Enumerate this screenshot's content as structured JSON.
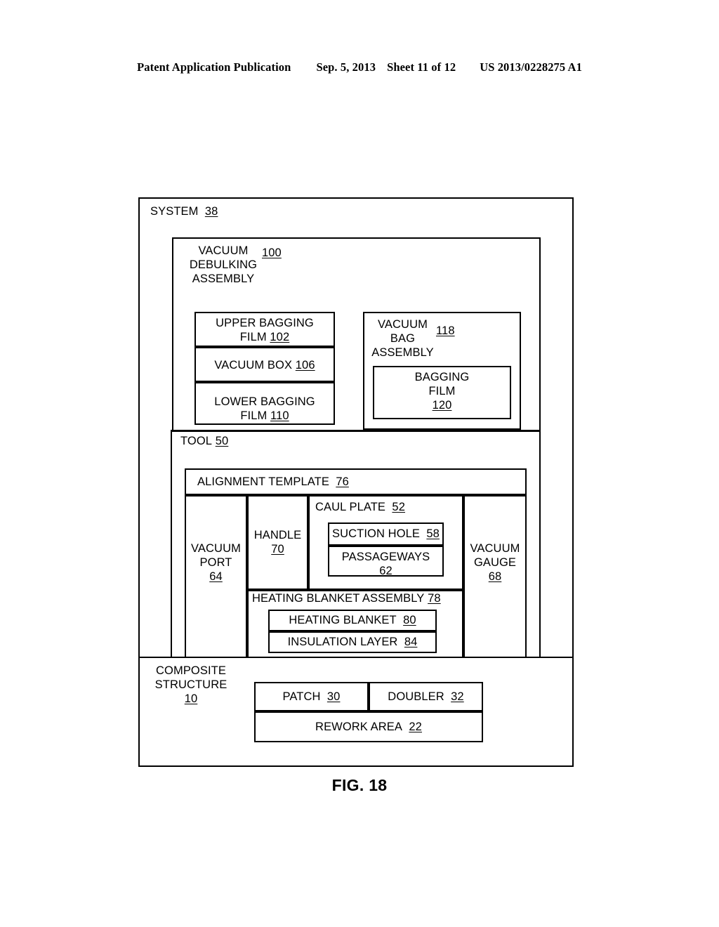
{
  "header": {
    "publication": "Patent Application Publication",
    "date": "Sep. 5, 2013",
    "sheet": "Sheet 11 of 12",
    "docnum": "US 2013/0228275 A1"
  },
  "figure": {
    "caption": "FIG. 18"
  },
  "diagram": {
    "system": {
      "label": "SYSTEM",
      "ref": "38"
    },
    "vacuum_debulking_assembly": {
      "label_line1": "VACUUM",
      "label_line2": "DEBULKING",
      "label_line3": "ASSEMBLY",
      "ref": "100",
      "children": [
        {
          "label": "UPPER BAGGING FILM",
          "label_line1": "UPPER BAGGING",
          "label_line2": "FILM",
          "ref": "102"
        },
        {
          "label": "VACUUM BOX",
          "ref": "106"
        },
        {
          "label": "LOWER BAGGING FILM",
          "label_line1": "LOWER BAGGING",
          "label_line2": "FILM",
          "ref": "110"
        }
      ],
      "vacuum_bag_assembly": {
        "label_line1": "VACUUM",
        "label_line2": "BAG",
        "label_line3": "ASSEMBLY",
        "ref": "118",
        "bagging_film": {
          "label_line1": "BAGGING",
          "label_line2": "FILM",
          "ref": "120"
        }
      }
    },
    "tool": {
      "label": "TOOL",
      "ref": "50",
      "alignment_template": {
        "label": "ALIGNMENT TEMPLATE",
        "ref": "76"
      },
      "vacuum_port": {
        "label_line1": "VACUUM",
        "label_line2": "PORT",
        "ref": "64"
      },
      "handle": {
        "label": "HANDLE",
        "ref": "70"
      },
      "caul_plate": {
        "label": "CAUL PLATE",
        "ref": "52",
        "suction_hole": {
          "label": "SUCTION HOLE",
          "ref": "58"
        },
        "passageways": {
          "label": "PASSAGEWAYS",
          "ref": "62"
        }
      },
      "vacuum_gauge": {
        "label_line1": "VACUUM",
        "label_line2": "GAUGE",
        "ref": "68"
      },
      "heating_blanket_assembly": {
        "label": "HEATING BLANKET ASSEMBLY",
        "ref": "78",
        "heating_blanket": {
          "label": "HEATING BLANKET",
          "ref": "80"
        },
        "insulation_layer": {
          "label": "INSULATION LAYER",
          "ref": "84"
        }
      }
    },
    "composite_structure": {
      "label_line1": "COMPOSITE",
      "label_line2": "STRUCTURE",
      "ref": "10",
      "patch": {
        "label": "PATCH",
        "ref": "30"
      },
      "doubler": {
        "label": "DOUBLER",
        "ref": "32"
      },
      "rework_area": {
        "label": "REWORK AREA",
        "ref": "22"
      }
    }
  }
}
